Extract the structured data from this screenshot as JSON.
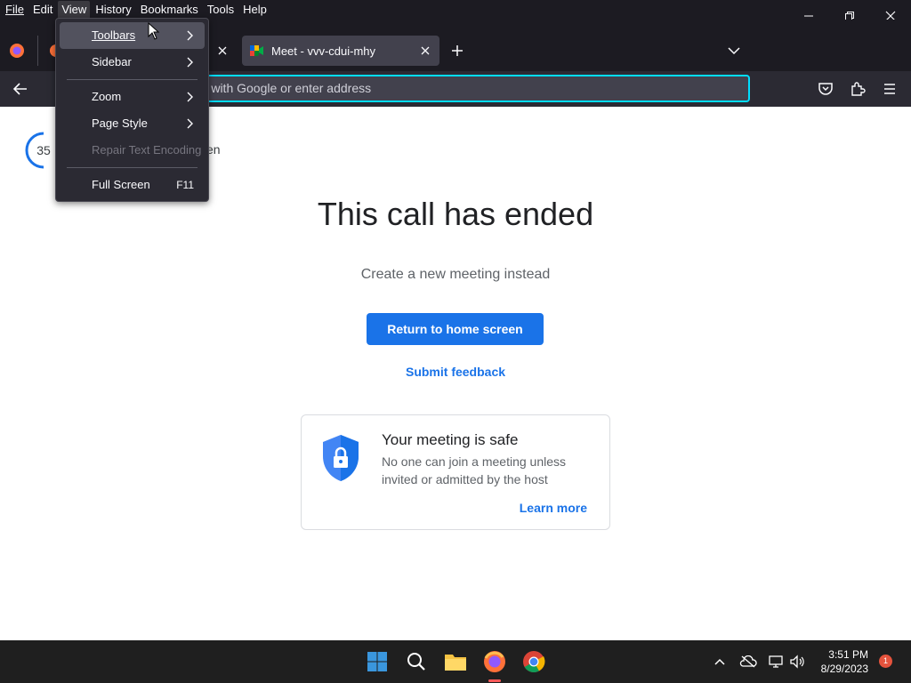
{
  "menubar": {
    "items": [
      {
        "label": "File"
      },
      {
        "label": "Edit"
      },
      {
        "label": "View"
      },
      {
        "label": "History"
      },
      {
        "label": "Bookmarks"
      },
      {
        "label": "Tools"
      },
      {
        "label": "Help"
      }
    ]
  },
  "tabs": {
    "active_title": "Meet - vvv-cdui-mhy"
  },
  "urlbar": {
    "placeholder": "Search with Google or enter address",
    "visible_text": "rch with Google or enter address"
  },
  "view_menu": {
    "items": [
      {
        "label": "Toolbars"
      },
      {
        "label": "Sidebar"
      },
      {
        "label": "Zoom"
      },
      {
        "label": "Page Style"
      },
      {
        "label": "Repair Text Encoding"
      },
      {
        "label": "Full Screen",
        "accel": "F11"
      }
    ]
  },
  "page": {
    "countdown": "35",
    "behind_text": "en",
    "title": "This call has ended",
    "subtitle": "Create a new meeting instead",
    "return_button": "Return to home screen",
    "feedback_link": "Submit feedback",
    "safe_card": {
      "title": "Your meeting is safe",
      "description": "No one can join a meeting unless invited or admitted by the host",
      "learn_more": "Learn more"
    }
  },
  "taskbar": {
    "time": "3:51 PM",
    "date": "8/29/2023",
    "notification_count": "1"
  },
  "colors": {
    "accent_blue": "#1a73e8",
    "firefox_dark": "#1c1b22",
    "focus_ring": "#00ddff"
  }
}
